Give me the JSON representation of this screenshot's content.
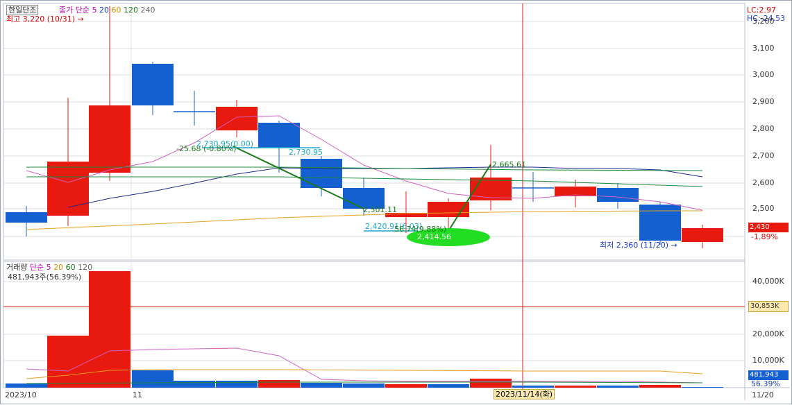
{
  "main": {
    "stock_name": "한일단조",
    "ma_legend": {
      "label": "종가 단순",
      "periods": [
        "5",
        "20",
        "60",
        "120",
        "240"
      ]
    },
    "high_marker": "최고 3,220 (10/31) →",
    "low_marker": "최저 2,360 (11/20) →",
    "lc": "LC:2.97",
    "hc": "HC:-24.53",
    "current_price": "2,430",
    "current_change": "-1.89%",
    "y_ticks": [
      "3,200",
      "3,100",
      "3,000",
      "2,900",
      "2,800",
      "2,700",
      "2,600",
      "2,500"
    ],
    "annotations": {
      "fib_left": "-25.68 (-0.80%)",
      "fib_left_value": "2,730.95(0.00)",
      "fib_mid": "2,730.95",
      "low_a": "2,501.11",
      "low_b": "2,420.91(6.03)",
      "pct": "56.74(9.88%)",
      "green_low": "2,414.56",
      "peak": "2,665.61"
    }
  },
  "volume": {
    "label": "거래량",
    "ma_legend": {
      "label": "단순",
      "periods": [
        "5",
        "20",
        "60",
        "120"
      ]
    },
    "current": "481,943주(56.39%)",
    "y_ticks": [
      "40,000K",
      "20,000K",
      "10,000K"
    ],
    "ref_value": "30,853K",
    "current_value": "481,943",
    "current_pct": "56.39%"
  },
  "x_axis": {
    "labels": [
      "2023/10",
      "11",
      "11/20"
    ],
    "cursor_date": "2023/11/14(화)"
  },
  "colors": {
    "up": "#e8190e",
    "down": "#1560d0",
    "ma5": "#d060c0",
    "ma20": "#1a2a8a",
    "ma60": "#e8a020",
    "ma120": "#1a8a3a",
    "ma240": "#606060"
  }
}
